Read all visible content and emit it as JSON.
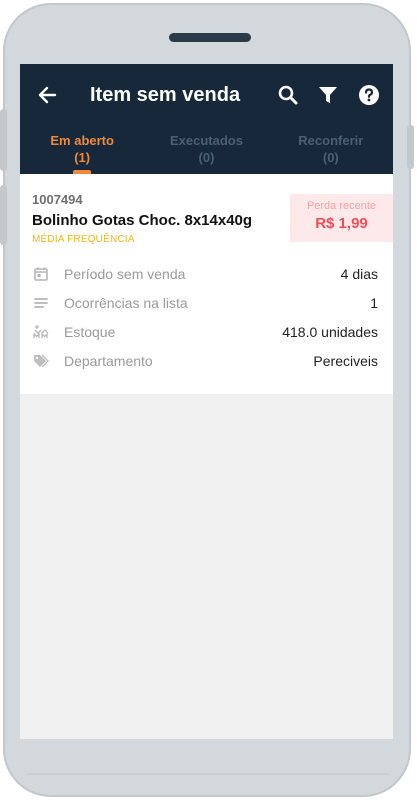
{
  "appbar": {
    "title": "Item sem venda",
    "back_icon": "arrow-left-icon",
    "actions": [
      "search-icon",
      "filter-icon",
      "help-icon"
    ]
  },
  "tabs": [
    {
      "label": "Em aberto",
      "count": "(1)",
      "active": true
    },
    {
      "label": "Executados",
      "count": "(0)",
      "active": false
    },
    {
      "label": "Reconferir",
      "count": "(0)",
      "active": false
    }
  ],
  "item": {
    "code": "1007494",
    "name": "Bolinho Gotas Choc. 8x14x40g",
    "frequency": "MÉDIA FREQUÊNCIA",
    "loss_label": "Perda recente",
    "loss_value": "R$ 1,99",
    "details": [
      {
        "icon": "calendar-icon",
        "label": "Período sem venda",
        "value": "4 dias"
      },
      {
        "icon": "list-icon",
        "label": "Ocorrências na lista",
        "value": "1"
      },
      {
        "icon": "stock-icon",
        "label": "Estoque",
        "value": "418.0 unidades"
      },
      {
        "icon": "tag-icon",
        "label": "Departamento",
        "value": "Pereciveis"
      }
    ]
  },
  "colors": {
    "appbar": "#16283a",
    "accent": "#f0893d",
    "frequency": "#f0b51e",
    "loss": "#ee4f57"
  }
}
